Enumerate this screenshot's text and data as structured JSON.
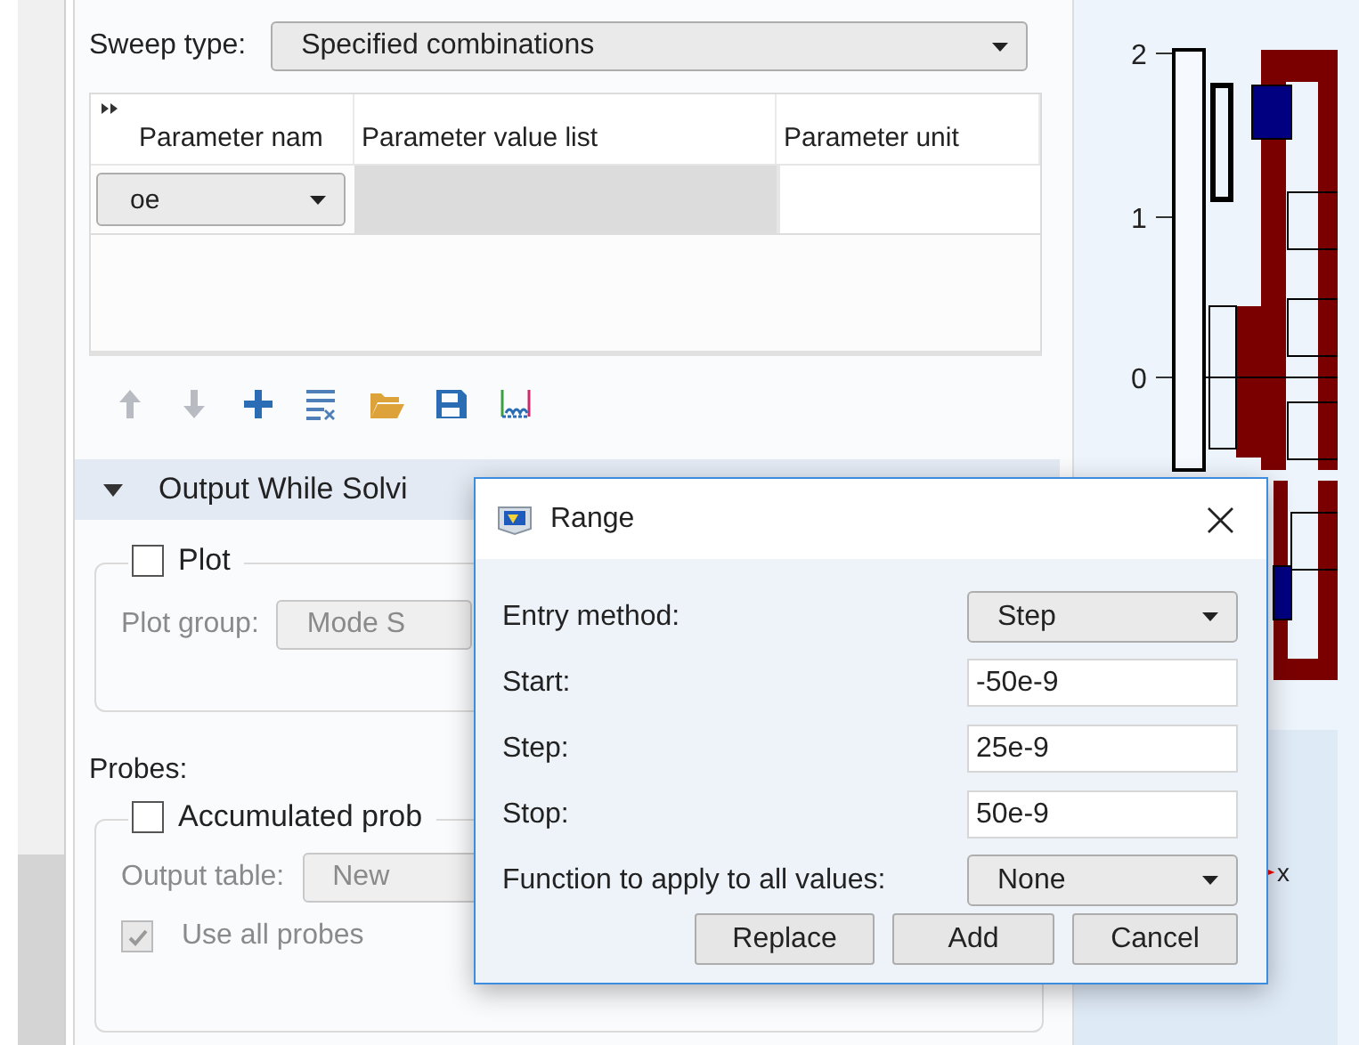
{
  "sweep": {
    "label": "Sweep type:",
    "value": "Specified combinations"
  },
  "table": {
    "columns": [
      "Parameter nam",
      "Parameter value list",
      "Parameter unit"
    ],
    "rows": [
      {
        "name": "oe"
      }
    ]
  },
  "toolbar": [
    {
      "kind": "up",
      "disabled": true
    },
    {
      "kind": "down",
      "disabled": true
    },
    {
      "kind": "add",
      "disabled": false
    },
    {
      "kind": "clear",
      "disabled": false
    },
    {
      "kind": "open",
      "disabled": false
    },
    {
      "kind": "save",
      "disabled": false
    },
    {
      "kind": "range",
      "disabled": false
    }
  ],
  "section": {
    "title": "Output While Solvi",
    "expanded": true
  },
  "plot": {
    "label": "Plot",
    "checked": false,
    "group_label": "Plot group:",
    "group_value": "Mode S"
  },
  "probes_label": "Probes:",
  "probes": {
    "label": "Accumulated prob",
    "checked": false,
    "table_label": "Output table:",
    "table_value": "New",
    "use_all": {
      "label": "Use all probes",
      "checked": true,
      "disabled": true
    }
  },
  "dialog": {
    "title": "Range",
    "close": "×",
    "fields": [
      {
        "kind": "select",
        "label": "Entry method:",
        "value": "Step"
      },
      {
        "kind": "input",
        "label": "Start:",
        "value": "-50e-9"
      },
      {
        "kind": "input",
        "label": "Step:",
        "value": "25e-9"
      },
      {
        "kind": "input",
        "label": "Stop:",
        "value": "50e-9"
      },
      {
        "kind": "select",
        "label": "Function to apply to all values:",
        "value": "None"
      }
    ],
    "buttons": [
      "Replace",
      "Add",
      "Cancel"
    ]
  },
  "graphics": {
    "ticks": [
      "2",
      "1",
      "0"
    ],
    "axis_label": "x"
  }
}
